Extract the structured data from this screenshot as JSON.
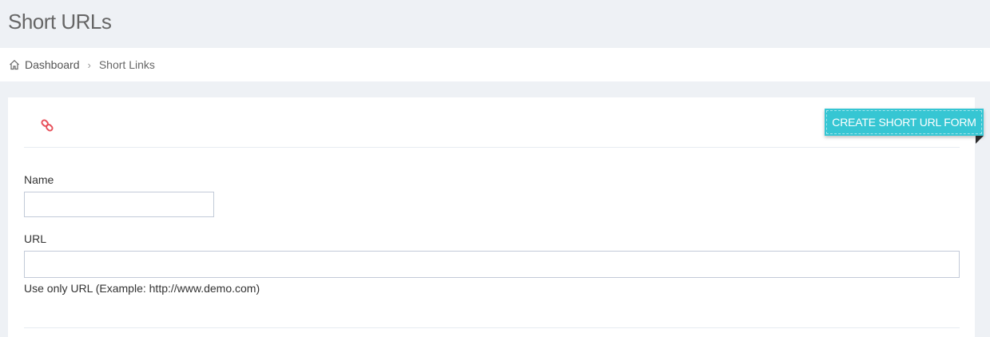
{
  "page": {
    "title": "Short URLs"
  },
  "breadcrumb": {
    "items": [
      {
        "label": "Dashboard",
        "icon": "home-icon"
      },
      {
        "label": "Short Links"
      }
    ],
    "separator": "›"
  },
  "portlet": {
    "icon": "link-icon",
    "icon_color": "#e7505a",
    "ribbon_label": "CREATE SHORT URL FORM",
    "ribbon_color": "#36c6d3"
  },
  "form": {
    "name_label": "Name",
    "name_value": "",
    "url_label": "URL",
    "url_value": "",
    "url_help": "Use only URL (Example: http://www.demo.com)"
  }
}
